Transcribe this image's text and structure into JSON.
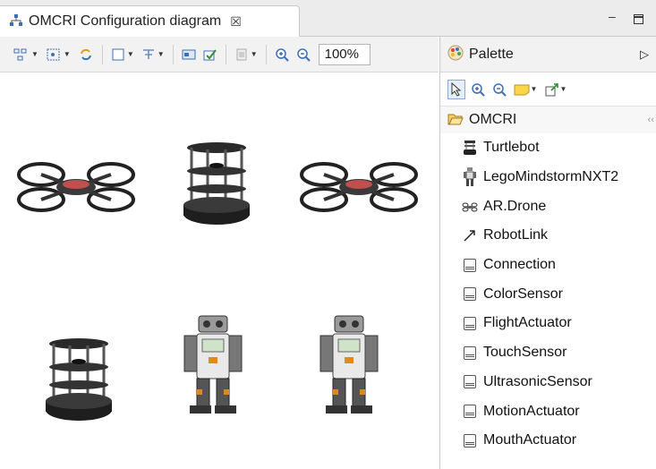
{
  "editor": {
    "tab_title": "OMCRI Configuration diagram",
    "tab_close_glyph": "☒",
    "tab_icon": "diagram-icon",
    "minimize_glyph": "–"
  },
  "toolbar": {
    "zoom_value": "100%",
    "items": [
      "arrange-icon",
      "select-all-icon",
      "refresh-icon",
      "fill-color-icon",
      "line-color-icon",
      "show-properties-icon",
      "validate-icon",
      "delete-icon",
      "zoom-in-icon",
      "zoom-out-icon"
    ]
  },
  "canvas": {
    "nodes": [
      {
        "type": "ar-drone"
      },
      {
        "type": "turtlebot"
      },
      {
        "type": "ar-drone"
      },
      {
        "type": "turtlebot"
      },
      {
        "type": "lego-nxt"
      },
      {
        "type": "lego-nxt"
      }
    ]
  },
  "palette": {
    "title": "Palette",
    "collapse_glyph": "▷",
    "drawer_label": "OMCRI",
    "drawer_pin": "‹‹",
    "items": [
      {
        "label": "Turtlebot",
        "icon": "turtlebot-icon"
      },
      {
        "label": "LegoMindstormNXT2",
        "icon": "lego-robot-icon"
      },
      {
        "label": "AR.Drone",
        "icon": "drone-icon"
      },
      {
        "label": "RobotLink",
        "icon": "link-arrow-icon"
      },
      {
        "label": "Connection",
        "icon": "class-icon"
      },
      {
        "label": "ColorSensor",
        "icon": "class-icon"
      },
      {
        "label": "FlightActuator",
        "icon": "class-icon"
      },
      {
        "label": "TouchSensor",
        "icon": "class-icon"
      },
      {
        "label": "UltrasonicSensor",
        "icon": "class-icon"
      },
      {
        "label": "MotionActuator",
        "icon": "class-icon"
      },
      {
        "label": "MouthActuator",
        "icon": "class-icon"
      }
    ]
  }
}
